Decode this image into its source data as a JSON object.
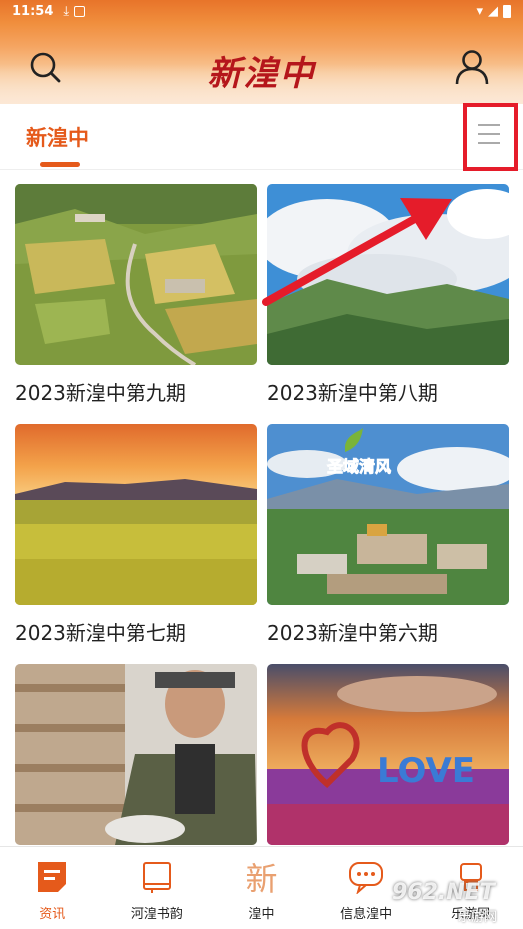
{
  "status_bar": {
    "time": "11:54"
  },
  "header": {
    "title": "新湟中"
  },
  "tabs": [
    {
      "label": "新湟中",
      "active": true
    }
  ],
  "cards": [
    {
      "caption": "2023新湟中第九期"
    },
    {
      "caption": "2023新湟中第八期"
    },
    {
      "caption": "2023新湟中第七期"
    },
    {
      "caption": "2023新湟中第六期"
    },
    {
      "caption": ""
    },
    {
      "caption": ""
    }
  ],
  "card_images": {
    "card5_inner_text": "圣域清风",
    "card6_inner_text": "LOVE"
  },
  "bottom_nav": [
    {
      "label": "资讯",
      "icon": "news-icon",
      "active": true
    },
    {
      "label": "河湟书韵",
      "icon": "book-icon",
      "active": false
    },
    {
      "label": "湟中",
      "icon": "xin-character-icon",
      "active": false
    },
    {
      "label": "信息湟中",
      "icon": "chat-bubble-icon",
      "active": false
    },
    {
      "label": "乐游网",
      "icon": "robot-icon",
      "active": false
    }
  ],
  "watermark": {
    "brand": "962.NET",
    "sub": "乐游网"
  },
  "colors": {
    "accent": "#e55a1b",
    "title_red": "#b5161b",
    "highlight_red": "#e51c2a"
  }
}
